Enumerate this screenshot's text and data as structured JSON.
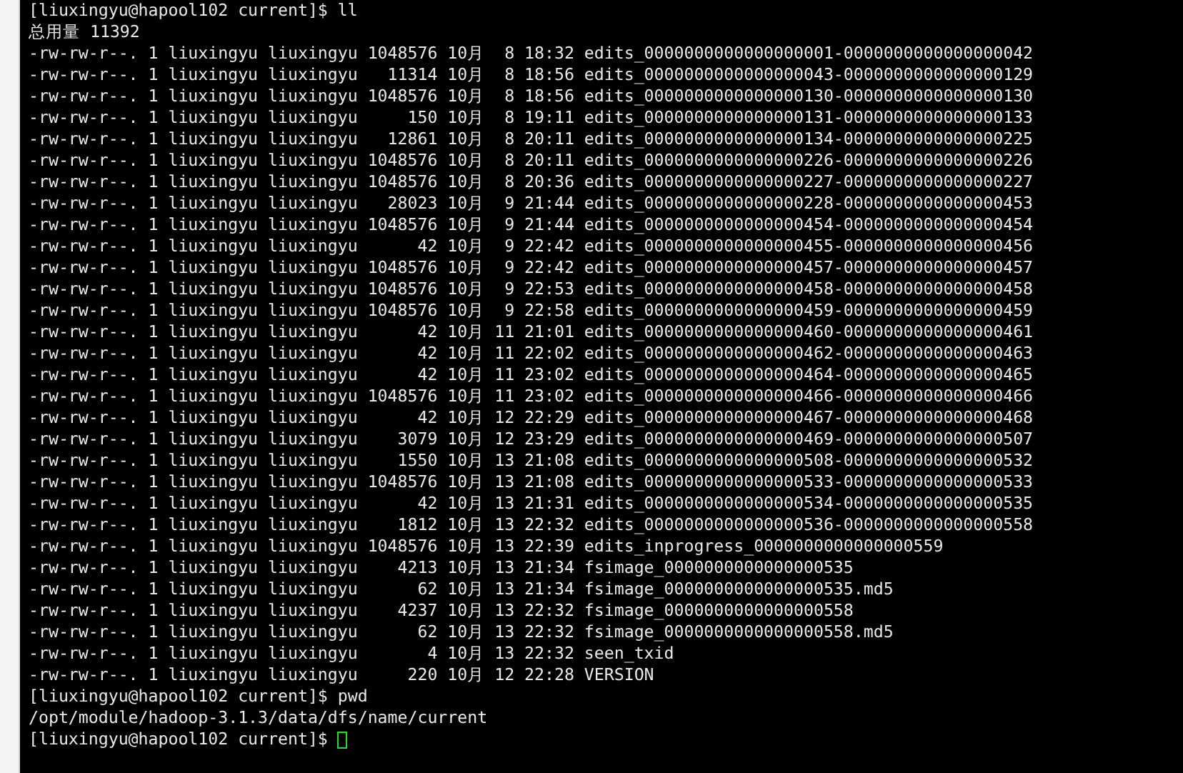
{
  "terminal": {
    "lines": [
      {
        "kind": "command",
        "text": "[liuxingyu@hapool102 current]$ ll"
      },
      {
        "kind": "output",
        "text": "总用量 11392"
      },
      {
        "kind": "output",
        "text": "-rw-rw-r--. 1 liuxingyu liuxingyu 1048576 10月  8 18:32 edits_0000000000000000001-0000000000000000042"
      },
      {
        "kind": "output",
        "text": "-rw-rw-r--. 1 liuxingyu liuxingyu   11314 10月  8 18:56 edits_0000000000000000043-0000000000000000129"
      },
      {
        "kind": "output",
        "text": "-rw-rw-r--. 1 liuxingyu liuxingyu 1048576 10月  8 18:56 edits_0000000000000000130-0000000000000000130"
      },
      {
        "kind": "output",
        "text": "-rw-rw-r--. 1 liuxingyu liuxingyu     150 10月  8 19:11 edits_0000000000000000131-0000000000000000133"
      },
      {
        "kind": "output",
        "text": "-rw-rw-r--. 1 liuxingyu liuxingyu   12861 10月  8 20:11 edits_0000000000000000134-0000000000000000225"
      },
      {
        "kind": "output",
        "text": "-rw-rw-r--. 1 liuxingyu liuxingyu 1048576 10月  8 20:11 edits_0000000000000000226-0000000000000000226"
      },
      {
        "kind": "output",
        "text": "-rw-rw-r--. 1 liuxingyu liuxingyu 1048576 10月  8 20:36 edits_0000000000000000227-0000000000000000227"
      },
      {
        "kind": "output",
        "text": "-rw-rw-r--. 1 liuxingyu liuxingyu   28023 10月  9 21:44 edits_0000000000000000228-0000000000000000453"
      },
      {
        "kind": "output",
        "text": "-rw-rw-r--. 1 liuxingyu liuxingyu 1048576 10月  9 21:44 edits_0000000000000000454-0000000000000000454"
      },
      {
        "kind": "output",
        "text": "-rw-rw-r--. 1 liuxingyu liuxingyu      42 10月  9 22:42 edits_0000000000000000455-0000000000000000456"
      },
      {
        "kind": "output",
        "text": "-rw-rw-r--. 1 liuxingyu liuxingyu 1048576 10月  9 22:42 edits_0000000000000000457-0000000000000000457"
      },
      {
        "kind": "output",
        "text": "-rw-rw-r--. 1 liuxingyu liuxingyu 1048576 10月  9 22:53 edits_0000000000000000458-0000000000000000458"
      },
      {
        "kind": "output",
        "text": "-rw-rw-r--. 1 liuxingyu liuxingyu 1048576 10月  9 22:58 edits_0000000000000000459-0000000000000000459"
      },
      {
        "kind": "output",
        "text": "-rw-rw-r--. 1 liuxingyu liuxingyu      42 10月 11 21:01 edits_0000000000000000460-0000000000000000461"
      },
      {
        "kind": "output",
        "text": "-rw-rw-r--. 1 liuxingyu liuxingyu      42 10月 11 22:02 edits_0000000000000000462-0000000000000000463"
      },
      {
        "kind": "output",
        "text": "-rw-rw-r--. 1 liuxingyu liuxingyu      42 10月 11 23:02 edits_0000000000000000464-0000000000000000465"
      },
      {
        "kind": "output",
        "text": "-rw-rw-r--. 1 liuxingyu liuxingyu 1048576 10月 11 23:02 edits_0000000000000000466-0000000000000000466"
      },
      {
        "kind": "output",
        "text": "-rw-rw-r--. 1 liuxingyu liuxingyu      42 10月 12 22:29 edits_0000000000000000467-0000000000000000468"
      },
      {
        "kind": "output",
        "text": "-rw-rw-r--. 1 liuxingyu liuxingyu    3079 10月 12 23:29 edits_0000000000000000469-0000000000000000507"
      },
      {
        "kind": "output",
        "text": "-rw-rw-r--. 1 liuxingyu liuxingyu    1550 10月 13 21:08 edits_0000000000000000508-0000000000000000532"
      },
      {
        "kind": "output",
        "text": "-rw-rw-r--. 1 liuxingyu liuxingyu 1048576 10月 13 21:08 edits_0000000000000000533-0000000000000000533"
      },
      {
        "kind": "output",
        "text": "-rw-rw-r--. 1 liuxingyu liuxingyu      42 10月 13 21:31 edits_0000000000000000534-0000000000000000535"
      },
      {
        "kind": "output",
        "text": "-rw-rw-r--. 1 liuxingyu liuxingyu    1812 10月 13 22:32 edits_0000000000000000536-0000000000000000558"
      },
      {
        "kind": "output",
        "text": "-rw-rw-r--. 1 liuxingyu liuxingyu 1048576 10月 13 22:39 edits_inprogress_0000000000000000559"
      },
      {
        "kind": "output",
        "text": "-rw-rw-r--. 1 liuxingyu liuxingyu    4213 10月 13 21:34 fsimage_0000000000000000535"
      },
      {
        "kind": "output",
        "text": "-rw-rw-r--. 1 liuxingyu liuxingyu      62 10月 13 21:34 fsimage_0000000000000000535.md5"
      },
      {
        "kind": "output",
        "text": "-rw-rw-r--. 1 liuxingyu liuxingyu    4237 10月 13 22:32 fsimage_0000000000000000558"
      },
      {
        "kind": "output",
        "text": "-rw-rw-r--. 1 liuxingyu liuxingyu      62 10月 13 22:32 fsimage_0000000000000000558.md5"
      },
      {
        "kind": "output",
        "text": "-rw-rw-r--. 1 liuxingyu liuxingyu       4 10月 13 22:32 seen_txid"
      },
      {
        "kind": "output",
        "text": "-rw-rw-r--. 1 liuxingyu liuxingyu     220 10月 12 22:28 VERSION"
      },
      {
        "kind": "command",
        "text": "[liuxingyu@hapool102 current]$ pwd"
      },
      {
        "kind": "output",
        "text": "/opt/module/hadoop-3.1.3/data/dfs/name/current"
      },
      {
        "kind": "input",
        "text": "[liuxingyu@hapool102 current]$ "
      }
    ]
  }
}
